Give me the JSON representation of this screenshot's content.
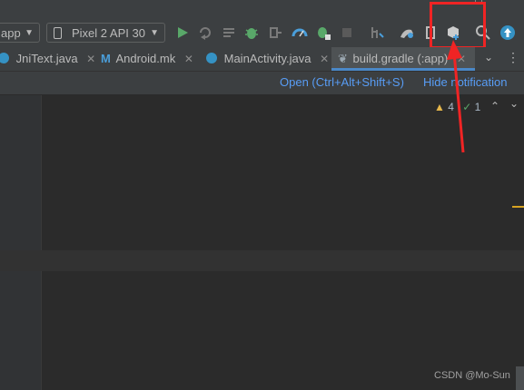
{
  "toolbar": {
    "module_label": "app",
    "device_label": "Pixel 2 API 30",
    "icons": [
      "run-icon",
      "apply-changes-icon",
      "profile-icon",
      "debug-icon",
      "attach-debugger-icon",
      "profiler-icon",
      "coverage-icon",
      "stop-icon",
      "sync-gradle-icon",
      "avd-manager-icon",
      "sdk-manager-icon",
      "device-manager-icon",
      "search-icon",
      "update-icon"
    ]
  },
  "tabs": [
    {
      "label": "JniText.java",
      "icon": "java-class-icon"
    },
    {
      "label": "Android.mk",
      "icon": "makefile-icon"
    },
    {
      "label": "MainActivity.java",
      "icon": "java-class-icon"
    },
    {
      "label": "build.gradle (:app)",
      "icon": "gradle-icon",
      "active": true
    }
  ],
  "notification": {
    "open_link": "Open (Ctrl+Alt+Shift+S)",
    "hide_link": "Hide notification"
  },
  "inspections": {
    "warnings": "4",
    "weak_warnings": "1"
  },
  "window": {
    "minimize": "—",
    "maximize": "☐"
  },
  "watermark": "CSDN @Mo-Sun",
  "colors": {
    "accent": "#589df6",
    "callout": "#f02424",
    "run_green": "#59a869",
    "warning": "#e6b74b"
  }
}
